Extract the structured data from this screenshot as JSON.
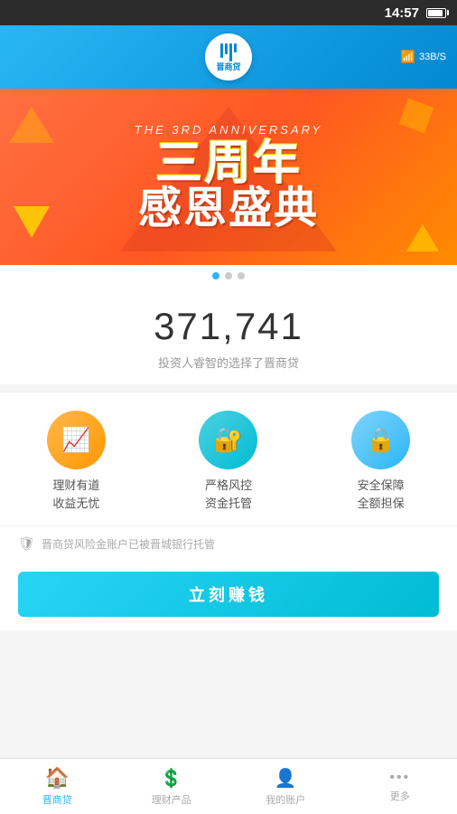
{
  "statusBar": {
    "time": "14:57",
    "speed": "33B/S"
  },
  "header": {
    "logoText": "晋商贷",
    "logoShort": "贷"
  },
  "banner": {
    "anniversary": "THE 3RD ANNIVERSARY",
    "line1": "三周年",
    "line2": "感恩盛典",
    "dots": [
      true,
      false,
      false
    ]
  },
  "stats": {
    "number": "371,741",
    "description": "投资人睿智的选择了晋商贷"
  },
  "features": [
    {
      "id": "finance",
      "icon": "📈",
      "label": "理财有道\n收益无忧"
    },
    {
      "id": "risk",
      "icon": "🔐",
      "label": "严格风控\n资金托管"
    },
    {
      "id": "security",
      "icon": "🔒",
      "label": "安全保障\n全额担保"
    }
  ],
  "notice": {
    "icon": "🛡",
    "text": "晋商贷风险金账户已被晋城银行托管"
  },
  "cta": {
    "label": "立刻赚钱"
  },
  "nav": [
    {
      "id": "home",
      "icon": "🏠",
      "label": "晋商贷",
      "active": true
    },
    {
      "id": "products",
      "icon": "💲",
      "label": "理财产品",
      "active": false
    },
    {
      "id": "account",
      "icon": "👤",
      "label": "我的账户",
      "active": false
    },
    {
      "id": "more",
      "icon": "···",
      "label": "更多",
      "active": false
    }
  ]
}
